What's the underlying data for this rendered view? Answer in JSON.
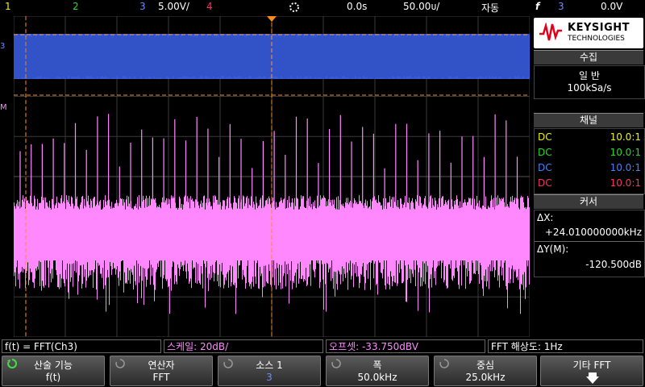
{
  "topbar": {
    "ch1": "1",
    "ch2": "2",
    "ch3": "3",
    "ch3_scale": "5.00V/",
    "ch4": "4",
    "delay": "0.0s",
    "timebase": "50.00ᴜ/",
    "trigger_mode": "자동",
    "trigger_symbol": "f",
    "trigger_source": "3",
    "trigger_level": "0.0V"
  },
  "panel": {
    "brand": "KEYSIGHT",
    "brand_sub": "TECHNOLOGIES",
    "acq_header": "수집",
    "acq_mode": "일 반",
    "acq_rate": "100kSa/s",
    "channels_header": "채널",
    "channels": [
      {
        "coupling": "DC",
        "probe": "10.0:1",
        "color": "#f0f000"
      },
      {
        "coupling": "DC",
        "probe": "10.0:1",
        "color": "#22dd22"
      },
      {
        "coupling": "DC",
        "probe": "10.0:1",
        "color": "#4a7dff"
      },
      {
        "coupling": "DC",
        "probe": "10.0:1",
        "color": "#ff3060"
      }
    ],
    "cursor_header": "커서",
    "dx_label": "ΔX:",
    "dx_value": "+24.010000000kHz",
    "dy_label": "ΔY(M):",
    "dy_value": "-120.500dB"
  },
  "strip": {
    "func": "f(t) = FFT(Ch3)",
    "scale": "스케일: 20dB/",
    "offset": "오프셋: -33.750dBV",
    "resolution": "FFT 해상도: 1Hz"
  },
  "softkeys": [
    {
      "title": "산술 기능",
      "value": "f(t)"
    },
    {
      "title": "연산자",
      "value": "FFT"
    },
    {
      "title": "소스 1",
      "value": "3"
    },
    {
      "title": "폭",
      "value": "50.0kHz"
    },
    {
      "title": "중심",
      "value": "25.0kHz"
    },
    {
      "title": "기타 FFT",
      "value": ""
    }
  ],
  "colors": {
    "ch3": "#3a5bd8",
    "math": "#ff88ff",
    "cursor": "#ff8c1a",
    "grid": "#3a3a3a"
  }
}
